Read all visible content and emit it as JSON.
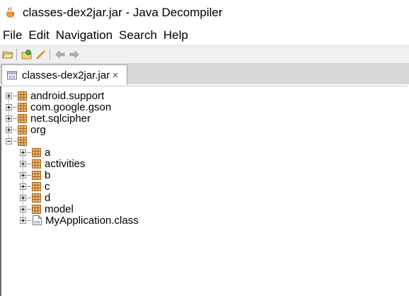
{
  "window": {
    "title": "classes-dex2jar.jar - Java Decompiler"
  },
  "menu": {
    "items": [
      {
        "label": "File"
      },
      {
        "label": "Edit"
      },
      {
        "label": "Navigation"
      },
      {
        "label": "Search"
      },
      {
        "label": "Help"
      }
    ]
  },
  "toolbar": {
    "buttons": [
      "open-file-icon",
      "open-type-icon",
      "search-icon",
      "back-icon",
      "forward-icon"
    ]
  },
  "tab": {
    "label": "classes-dex2jar.jar",
    "icon": "jar-icon"
  },
  "tree": {
    "top_level": [
      {
        "label": "android.support",
        "expanded": false
      },
      {
        "label": "com.google.gson",
        "expanded": false
      },
      {
        "label": "net.sqlcipher",
        "expanded": false
      },
      {
        "label": "org",
        "expanded": false
      },
      {
        "label": "",
        "expanded": true
      }
    ],
    "children": [
      {
        "label": "a",
        "type": "package"
      },
      {
        "label": "activities",
        "type": "package"
      },
      {
        "label": "b",
        "type": "package"
      },
      {
        "label": "c",
        "type": "package"
      },
      {
        "label": "d",
        "type": "package"
      },
      {
        "label": "model",
        "type": "package"
      },
      {
        "label": "MyApplication.class",
        "type": "class"
      }
    ]
  },
  "colors": {
    "package_icon": "#c87a2a",
    "tab_bar": "#d8d8d8",
    "toolbar": "#f0f0f0"
  }
}
